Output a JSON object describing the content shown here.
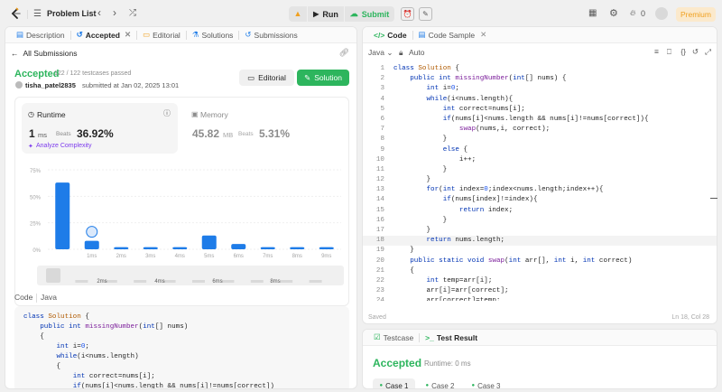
{
  "topbar": {
    "problem_list": "Problem List",
    "run": "Run",
    "submit": "Submit",
    "streak": "0",
    "premium": "Premium"
  },
  "left": {
    "tabs": [
      {
        "label": "Description"
      },
      {
        "label": "Accepted"
      },
      {
        "label": "Editorial"
      },
      {
        "label": "Solutions"
      },
      {
        "label": "Submissions"
      }
    ],
    "all_submissions": "All Submissions",
    "status": "Accepted",
    "passed": "122 / 122 testcases passed",
    "user": "tisha_patel2835",
    "submitted": "submitted at Jan 02, 2025 13:01",
    "editorial_btn": "Editorial",
    "solution_btn": "Solution",
    "runtime": {
      "label": "Runtime",
      "value": "1",
      "unit": "ms",
      "beats": "Beats",
      "pct": "36.92%",
      "analyze": "Analyze Complexity"
    },
    "memory": {
      "label": "Memory",
      "value": "45.82",
      "unit": "MB",
      "beats": "Beats",
      "pct": "5.31%"
    },
    "code_label": "Code",
    "lang": "Java",
    "preview_code": [
      "class Solution {",
      "    public int missingNumber(int[] nums)",
      "    {",
      "        int i=0;",
      "        while(i<nums.length)",
      "        {",
      "            int correct=nums[i];",
      "            if(nums[i]<nums.length && nums[i]!=nums[correct])"
    ]
  },
  "chart_data": {
    "type": "bar",
    "yticks": [
      "75%",
      "50%",
      "25%",
      "0%"
    ],
    "categories": [
      "",
      "1ms",
      "2ms",
      "3ms",
      "4ms",
      "5ms",
      "6ms",
      "7ms",
      "8ms",
      "9ms"
    ],
    "values": [
      63,
      8,
      2,
      2,
      2,
      13,
      5,
      2,
      2,
      2
    ],
    "ylim": [
      0,
      75
    ],
    "mini_labels": [
      "2ms",
      "4ms",
      "6ms",
      "8ms"
    ]
  },
  "right": {
    "code_tab": "Code",
    "sample_tab": "Code Sample",
    "lang": "Java",
    "auto": "Auto",
    "lines": [
      "class Solution {",
      "    public int missingNumber(int[] nums) {",
      "        int i=0;",
      "        while(i<nums.length){",
      "            int correct=nums[i];",
      "            if(nums[i]<nums.length && nums[i]!=nums[correct]){",
      "                swap(nums,i, correct);",
      "            }",
      "            else {",
      "                i++;",
      "            }",
      "        }",
      "        for(int index=0;index<nums.length;index++){",
      "            if(nums[index]!=index){",
      "                return index;",
      "            }",
      "        }",
      "        return nums.length;",
      "    }",
      "    public static void swap(int arr[], int i, int correct)",
      "    {",
      "        int temp=arr[i];",
      "        arr[i]=arr[correct];",
      "        arr[correct]=temp;"
    ],
    "saved": "Saved",
    "cursor": "Ln 18, Col 28",
    "testcase_tab": "Testcase",
    "result_tab": "Test Result",
    "result": "Accepted",
    "runtime": "Runtime: 0 ms",
    "cases": [
      "Case 1",
      "Case 2",
      "Case 3"
    ]
  }
}
